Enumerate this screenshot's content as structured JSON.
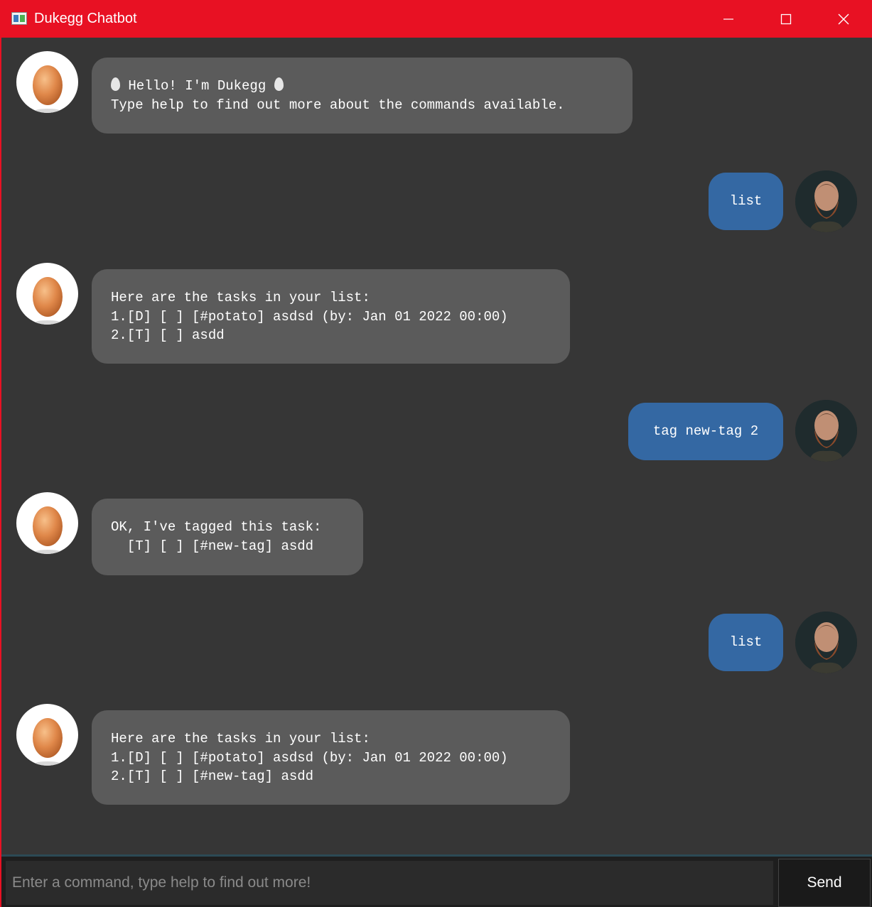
{
  "window": {
    "title": "Dukegg Chatbot",
    "title_color": "#e81123"
  },
  "messages": [
    {
      "sender": "bot",
      "lines": [
        "Hello! I'm Dukegg",
        "Type help to find out more about the commands available."
      ]
    },
    {
      "sender": "user",
      "text": "list"
    },
    {
      "sender": "bot",
      "lines": [
        "Here are the tasks in your list:",
        "1.[D] [ ] [#potato] asdsd (by: Jan 01 2022 00:00)",
        "2.[T] [ ] asdd"
      ]
    },
    {
      "sender": "user",
      "text": "tag new-tag 2"
    },
    {
      "sender": "bot",
      "lines": [
        "OK, I've tagged this task:",
        "  [T] [ ] [#new-tag] asdd"
      ]
    },
    {
      "sender": "user",
      "text": "list"
    },
    {
      "sender": "bot",
      "lines": [
        "Here are the tasks in your list:",
        "1.[D] [ ] [#potato] asdsd (by: Jan 01 2022 00:00)",
        "2.[T] [ ] [#new-tag] asdd"
      ]
    }
  ],
  "input": {
    "placeholder": "Enter a command, type help to find out more!",
    "value": ""
  },
  "send_label": "Send",
  "colors": {
    "background": "#363636",
    "bot_bubble": "#5b5b5b",
    "user_bubble": "#3468a3",
    "input_bar": "#1e1e1e"
  },
  "icons": {
    "bot_avatar": "egg-avatar",
    "user_avatar": "bearded-man-avatar"
  }
}
